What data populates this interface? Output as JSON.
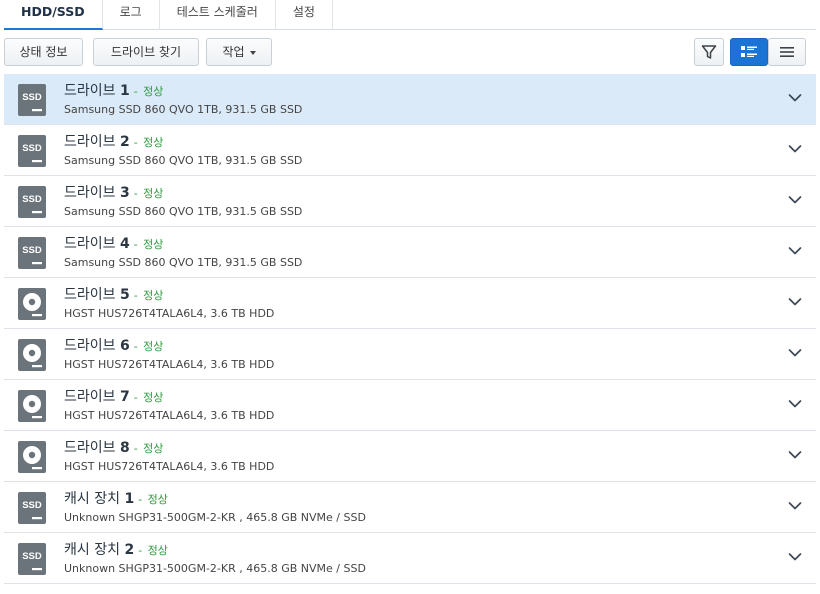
{
  "tabs": [
    {
      "label": "HDD/SSD",
      "active": true
    },
    {
      "label": "로그",
      "active": false
    },
    {
      "label": "테스트 스케줄러",
      "active": false
    },
    {
      "label": "설정",
      "active": false
    }
  ],
  "toolbar": {
    "status_info_label": "상태 정보",
    "find_drive_label": "드라이브 찾기",
    "action_label": "작업",
    "active_view": "detail-view",
    "accent_color": "#1b74d4"
  },
  "drives": [
    {
      "name": "드라이브",
      "number": "1",
      "status": "정상",
      "desc": "Samsung SSD 860 QVO 1TB, 931.5 GB SSD",
      "icon": "ssd-icon",
      "icon_text": "SSD",
      "selected": true
    },
    {
      "name": "드라이브",
      "number": "2",
      "status": "정상",
      "desc": "Samsung SSD 860 QVO 1TB, 931.5 GB SSD",
      "icon": "ssd-icon",
      "icon_text": "SSD",
      "selected": false
    },
    {
      "name": "드라이브",
      "number": "3",
      "status": "정상",
      "desc": "Samsung SSD 860 QVO 1TB, 931.5 GB SSD",
      "icon": "ssd-icon",
      "icon_text": "SSD",
      "selected": false
    },
    {
      "name": "드라이브",
      "number": "4",
      "status": "정상",
      "desc": "Samsung SSD 860 QVO 1TB, 931.5 GB SSD",
      "icon": "ssd-icon",
      "icon_text": "SSD",
      "selected": false
    },
    {
      "name": "드라이브",
      "number": "5",
      "status": "정상",
      "desc": "HGST HUS726T4TALA6L4, 3.6 TB HDD",
      "icon": "hdd-icon",
      "icon_text": "",
      "selected": false
    },
    {
      "name": "드라이브",
      "number": "6",
      "status": "정상",
      "desc": "HGST HUS726T4TALA6L4, 3.6 TB HDD",
      "icon": "hdd-icon",
      "icon_text": "",
      "selected": false
    },
    {
      "name": "드라이브",
      "number": "7",
      "status": "정상",
      "desc": "HGST HUS726T4TALA6L4, 3.6 TB HDD",
      "icon": "hdd-icon",
      "icon_text": "",
      "selected": false
    },
    {
      "name": "드라이브",
      "number": "8",
      "status": "정상",
      "desc": "HGST HUS726T4TALA6L4, 3.6 TB HDD",
      "icon": "hdd-icon",
      "icon_text": "",
      "selected": false
    },
    {
      "name": "캐시 장치",
      "number": "1",
      "status": "정상",
      "desc": "Unknown SHGP31-500GM-2-KR , 465.8 GB NVMe / SSD",
      "icon": "ssd-icon",
      "icon_text": "SSD",
      "selected": false
    },
    {
      "name": "캐시 장치",
      "number": "2",
      "status": "정상",
      "desc": "Unknown SHGP31-500GM-2-KR , 465.8 GB NVMe / SSD",
      "icon": "ssd-icon",
      "icon_text": "SSD",
      "selected": false
    }
  ],
  "colors": {
    "status_ok": "#2f9a3e",
    "selected_row": "#dbeaf9",
    "icon_gray": "#6b737b"
  }
}
